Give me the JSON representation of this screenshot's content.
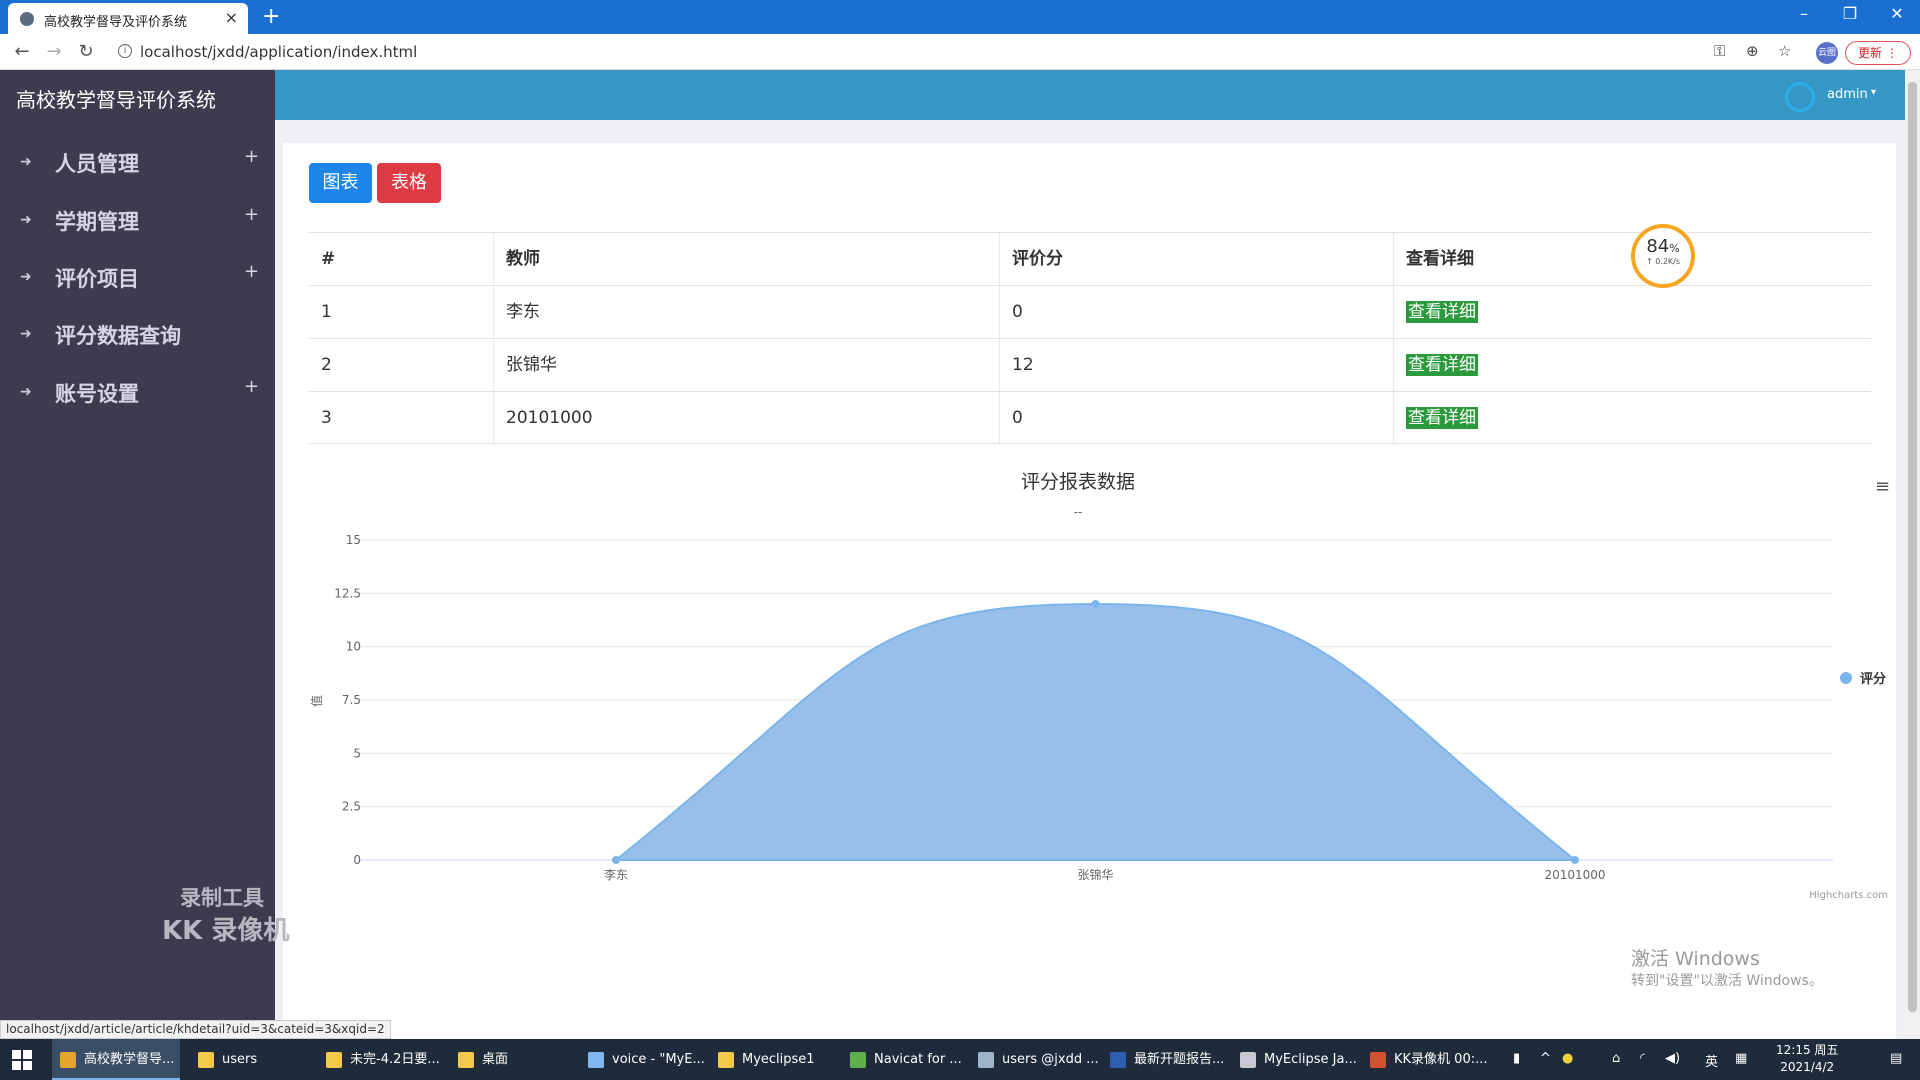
{
  "browser": {
    "tab_title": "高校教学督导及评价系统",
    "tab_close": "×",
    "new_tab": "+",
    "url": "localhost/jxdd/application/index.html",
    "update_label": "更新",
    "profile_label": "云图"
  },
  "sidebar": {
    "brand": "高校教学督导评价系统",
    "items": [
      {
        "label": "人员管理",
        "has_plus": true
      },
      {
        "label": "学期管理",
        "has_plus": true
      },
      {
        "label": "评价项目",
        "has_plus": true
      },
      {
        "label": "评分数据查询",
        "has_plus": false
      },
      {
        "label": "账号设置",
        "has_plus": true
      }
    ],
    "watermark_line1": "录制工具",
    "watermark_line2": "KK 录像机"
  },
  "header": {
    "user": "admin"
  },
  "toolbar": {
    "chart_label": "图表",
    "table_label": "表格"
  },
  "table": {
    "headers": [
      "#",
      "教师",
      "评价分",
      "查看详细"
    ],
    "rows": [
      {
        "index": "1",
        "teacher": "李东",
        "score": "0",
        "action": "查看详细"
      },
      {
        "index": "2",
        "teacher": "张锦华",
        "score": "12",
        "action": "查看详细"
      },
      {
        "index": "3",
        "teacher": "20101000",
        "score": "0",
        "action": "查看详细"
      }
    ]
  },
  "speed_widget": {
    "percent": "84",
    "percent_sign": "%",
    "rate": "↑ 0.2K/s"
  },
  "chart_data": {
    "type": "area",
    "title": "评分报表数据",
    "subtitle": "--",
    "categories": [
      "李东",
      "张锦华",
      "20101000"
    ],
    "series": [
      {
        "name": "评分",
        "values": [
          0,
          12,
          0
        ]
      }
    ],
    "ylabel": "值",
    "ylim": [
      0,
      15
    ],
    "yticks": [
      "0",
      "2.5",
      "5",
      "7.5",
      "10",
      "12.5",
      "15"
    ],
    "legend_position": "right",
    "credits": "Highcharts.com",
    "color": "#97bfe9"
  },
  "status_bar_url": "localhost/jxdd/article/article/khdetail?uid=3&cateid=3&xqid=2",
  "activation": {
    "line1": "激活 Windows",
    "line2": "转到\"设置\"以激活 Windows。"
  },
  "taskbar": {
    "tasks": [
      {
        "label": "高校教学督导...",
        "color": "#e5a52a"
      },
      {
        "label": "users",
        "color": "#f3c94b"
      },
      {
        "label": "未完-4.2日要...",
        "color": "#f3c94b"
      },
      {
        "label": "桌面",
        "color": "#f3c94b"
      },
      {
        "label": "voice - \"MyE...",
        "color": "#7fb8ee"
      },
      {
        "label": "Myeclipse1",
        "color": "#f3c94b"
      },
      {
        "label": "Navicat for ...",
        "color": "#5fb04a"
      },
      {
        "label": "users @jxdd ...",
        "color": "#9db4c9"
      },
      {
        "label": "最新开题报告...",
        "color": "#2b5fb4"
      },
      {
        "label": "MyEclipse Ja...",
        "color": "#c7c7d6"
      },
      {
        "label": "KK录像机 00:...",
        "color": "#d2502d"
      }
    ],
    "ime": "英",
    "time": "12:15 周五",
    "date": "2021/4/2"
  }
}
